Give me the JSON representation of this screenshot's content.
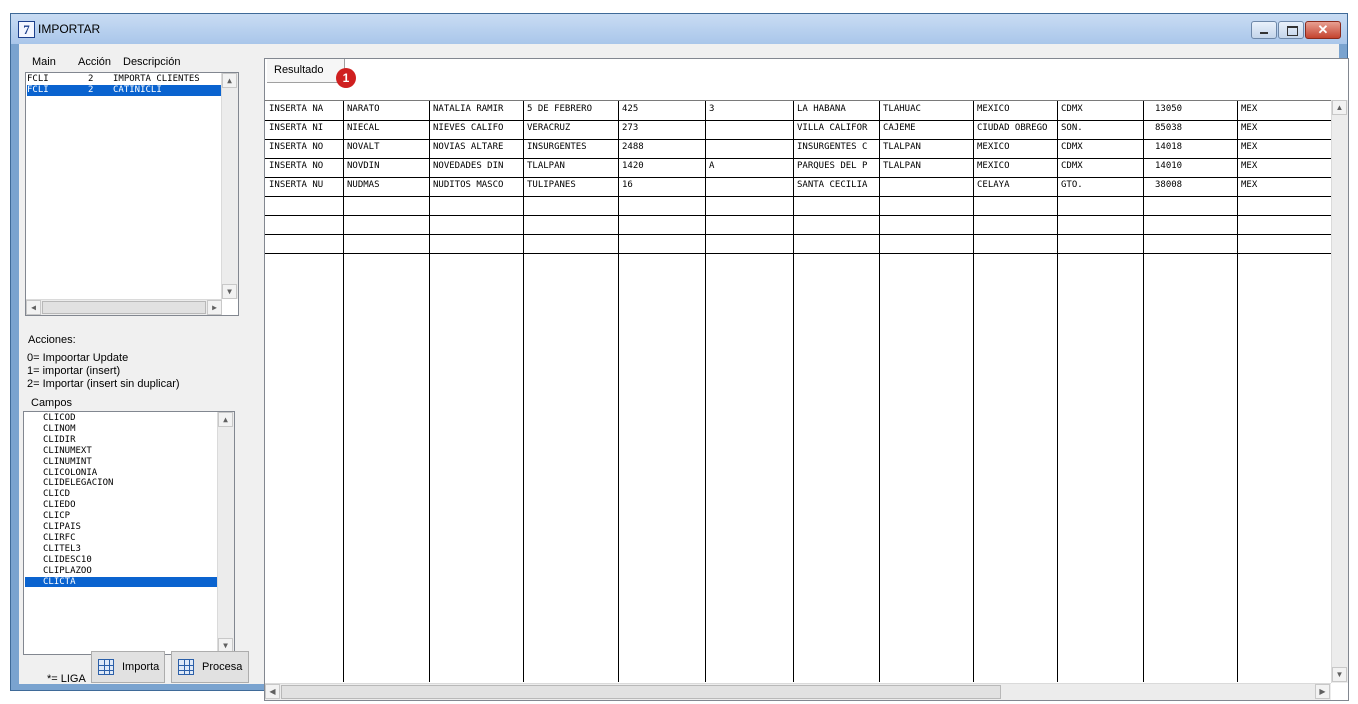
{
  "window": {
    "title": "IMPORTAR",
    "app_icon_glyph": "7"
  },
  "left": {
    "header_main": "Main",
    "header_accion": "Acción",
    "header_descripcion": "Descripción",
    "mains": [
      {
        "main": "FCLI",
        "accion": "2",
        "descripcion": "IMPORTA CLIENTES"
      },
      {
        "main": "FCLI",
        "accion": "2",
        "descripcion": "CATINICLI"
      }
    ],
    "acciones_title": "Acciones:",
    "acciones": [
      "0= Impoortar Update",
      "1= importar (insert)",
      "2= Importar (insert sin duplicar)"
    ],
    "campos_title": "Campos",
    "campos": [
      "CLICOD",
      "CLINOM",
      "CLIDIR",
      "CLINUMEXT",
      "CLINUMINT",
      "CLICOLONIA",
      "CLIDELEGACION",
      "CLICD",
      "CLIEDO",
      "CLICP",
      "CLIPAIS",
      "CLIRFC",
      "CLITEL3",
      "CLIDESC10",
      "CLIPLAZOO",
      "CLICTA"
    ],
    "liga_label": "*= LIGA",
    "importa_label": "Importa",
    "procesa_label": "Procesa"
  },
  "result": {
    "tab_label": "Resultado",
    "badge": "1",
    "rows": [
      [
        "INSERTA NA",
        "NARATO",
        "NATALIA RAMIR",
        "5 DE FEBRERO",
        "425",
        "3",
        "LA HABANA",
        "TLAHUAC",
        "MEXICO",
        "CDMX",
        "13050",
        "MEX"
      ],
      [
        "INSERTA NI",
        "NIECAL",
        "NIEVES CALIFO",
        "VERACRUZ",
        "273",
        "",
        "VILLA CALIFOR",
        "CAJEME",
        "CIUDAD OBREGO",
        "SON.",
        "85038",
        "MEX"
      ],
      [
        "INSERTA NO",
        "NOVALT",
        "NOVIAS ALTARE",
        "INSURGENTES",
        "2488",
        "",
        "INSURGENTES C",
        "TLALPAN",
        "MEXICO",
        "CDMX",
        "14018",
        "MEX"
      ],
      [
        "INSERTA NO",
        "NOVDIN",
        "NOVEDADES DIN",
        "TLALPAN",
        "1420",
        "A",
        "PARQUES DEL P",
        "TLALPAN",
        "MEXICO",
        "CDMX",
        "14010",
        "MEX"
      ],
      [
        "INSERTA NU",
        "NUDMAS",
        "NUDITOS MASCO",
        "TULIPANES",
        "16",
        "",
        "SANTA CECILIA",
        "",
        "CELAYA",
        "GTO.",
        "38008",
        "MEX"
      ],
      [
        "",
        "",
        "",
        "",
        "",
        "",
        "",
        "",
        "",
        "",
        "",
        ""
      ],
      [
        "",
        "",
        "",
        "",
        "",
        "",
        "",
        "",
        "",
        "",
        "",
        ""
      ],
      [
        "",
        "",
        "",
        "",
        "",
        "",
        "",
        "",
        "",
        "",
        "",
        ""
      ]
    ]
  }
}
